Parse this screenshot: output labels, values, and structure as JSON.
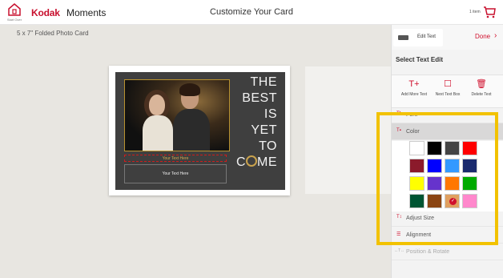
{
  "header": {
    "home_caption": "Start Over",
    "brand": "Kodak",
    "brand_suffix": "Moments",
    "title": "Customize Your Card",
    "cart_count": "1 item"
  },
  "canvas": {
    "product_label": "5 x 7\" Folded Photo Card",
    "card": {
      "text_box_1": "Your Text Here",
      "text_box_2": "Your Text Here",
      "quote_lines": [
        "THE",
        "BEST",
        "IS",
        "YET",
        "TO"
      ],
      "quote_last_prefix": "C",
      "quote_last_suffix": "ME"
    }
  },
  "panel": {
    "tab_label": "Edit Text",
    "done_label": "Done",
    "title": "Select Text Edit",
    "tools": [
      {
        "label": "Add More Text",
        "icon": "text-plus-icon",
        "glyph": "T+"
      },
      {
        "label": "Next Text Box",
        "icon": "next-box-icon",
        "glyph": "☐"
      },
      {
        "label": "Delete Text",
        "icon": "trash-icon",
        "glyph": "🗑"
      }
    ],
    "menu": [
      {
        "label": "Font",
        "glyph": "Tt"
      },
      {
        "label": "Color",
        "glyph": "T▪"
      },
      {
        "label": "Adjust Size",
        "glyph": "T↕"
      },
      {
        "label": "Alignment",
        "glyph": "☰"
      },
      {
        "label": "Position & Rotate",
        "glyph": "↔T↔"
      }
    ],
    "swatch_colors": [
      "#ffffff",
      "#000000",
      "#444444",
      "#ff0000",
      "#8b1a2b",
      "#0000ff",
      "#3399ff",
      "#1a2a6e",
      "#ffff00",
      "#6633cc",
      "#ff7700",
      "#00aa00",
      "#005533",
      "#8b4513",
      "#e0a060",
      "#ff88cc"
    ],
    "selected_swatch": 14
  }
}
